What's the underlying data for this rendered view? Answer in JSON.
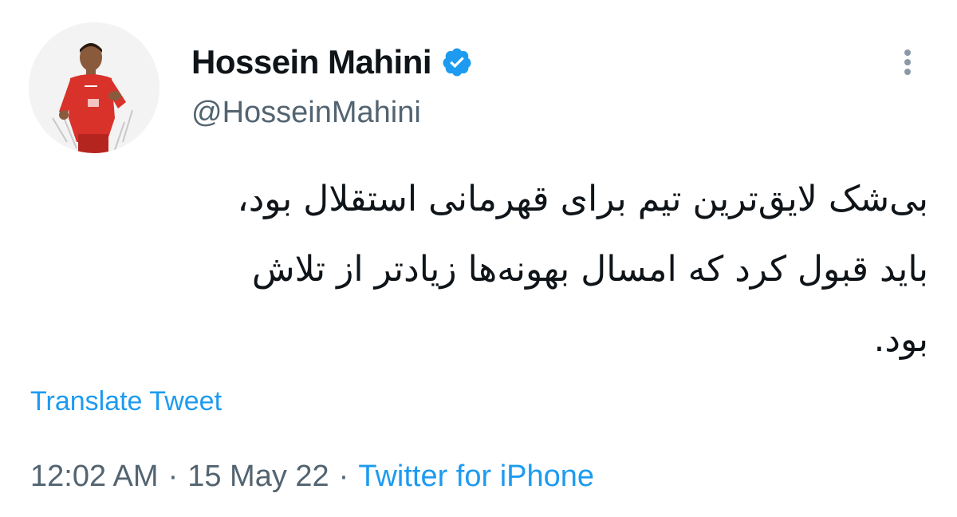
{
  "user": {
    "display_name": "Hossein Mahini",
    "handle": "@HosseinMahini",
    "verified_icon": "verified-badge-icon",
    "avatar": "player-avatar"
  },
  "tweet": {
    "text_lines": [
      "بی‌شک لایق‌ترین تیم برای قهرمانی استقلال بود،",
      "باید قبول کرد که امسال بهونه‌ها زیادتر از تلاش",
      "بود."
    ],
    "translate_label": "Translate Tweet"
  },
  "meta": {
    "time": "12:02 AM",
    "separator": "·",
    "date": "15 May 22",
    "source": "Twitter for iPhone"
  },
  "colors": {
    "accent": "#1d9bf0",
    "secondary_text": "#536471",
    "primary_text": "#0f1419",
    "jersey_red": "#d9322b"
  },
  "icons": {
    "more": "more-options-icon"
  }
}
